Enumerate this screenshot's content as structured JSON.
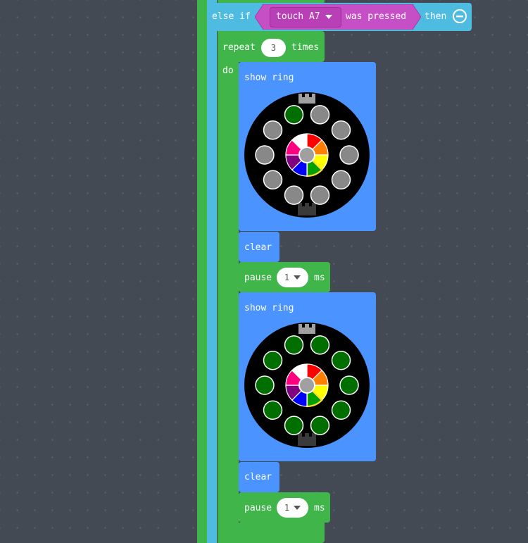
{
  "else_if_block": {
    "else_if_label": "else if",
    "touch_option": "touch A7",
    "was_pressed_label": "was pressed",
    "then_label": "then",
    "remove_icon": "minus-circle-icon"
  },
  "repeat_block": {
    "repeat_label": "repeat",
    "count": "3",
    "times_label": "times",
    "do_label": "do"
  },
  "body": [
    {
      "type": "show ring",
      "label": "show ring",
      "pixels": [
        "#888888",
        "#888888",
        "#888888",
        "#888888",
        "#888888",
        "#888888",
        "#888888",
        "#888888",
        "#888888",
        "#006f00"
      ]
    },
    {
      "type": "clear",
      "label": "clear"
    },
    {
      "type": "pause",
      "label": "pause",
      "value": "1",
      "unit": "ms"
    },
    {
      "type": "show ring",
      "label": "show ring",
      "pixels": [
        "#006f00",
        "#006f00",
        "#006f00",
        "#006f00",
        "#006f00",
        "#006f00",
        "#006f00",
        "#006f00",
        "#006f00",
        "#006f00"
      ]
    },
    {
      "type": "clear",
      "label": "clear"
    },
    {
      "type": "pause",
      "label": "pause",
      "value": "1",
      "unit": "ms"
    }
  ],
  "palette_colors": [
    "#ff0000",
    "#ff8000",
    "#ffff00",
    "#00a000",
    "#0000ff",
    "#800080",
    "#ff0080",
    "#ffffff"
  ],
  "colors": {
    "workspace": "#434a53",
    "loops": "#3fb54a",
    "light": "#4b94ff",
    "logic": "#4ebce0",
    "input": "#c74fc6"
  }
}
